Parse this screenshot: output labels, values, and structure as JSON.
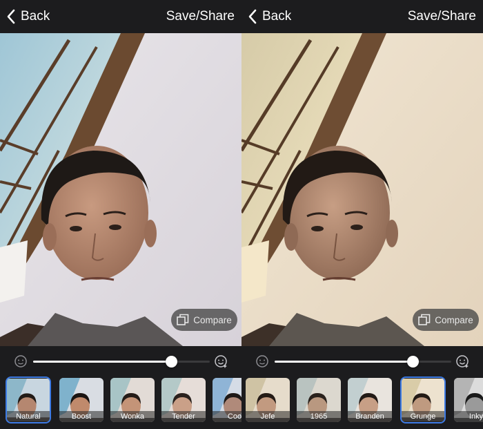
{
  "colors": {
    "accent": "#3d7be6",
    "bar_bg": "#1c1c1e",
    "text": "#ffffff"
  },
  "panels": [
    {
      "back_label": "Back",
      "save_label": "Save/Share",
      "compare_label": "Compare",
      "slider_level": 0.78,
      "selected_filter": "Natural",
      "filters": [
        "Natural",
        "Boost",
        "Wonka",
        "Tender",
        "Coo"
      ],
      "tone": "cool"
    },
    {
      "back_label": "Back",
      "save_label": "Save/Share",
      "compare_label": "Compare",
      "slider_level": 0.78,
      "selected_filter": "Grunge",
      "filters": [
        "Jefe",
        "1965",
        "Branden",
        "Grunge",
        "Inky"
      ],
      "tone": "warm"
    }
  ],
  "icons": {
    "back": "chevron-left-icon",
    "compare": "compare-layers-icon",
    "slider_min": "face-neutral-icon",
    "slider_max": "face-sparkle-icon"
  }
}
